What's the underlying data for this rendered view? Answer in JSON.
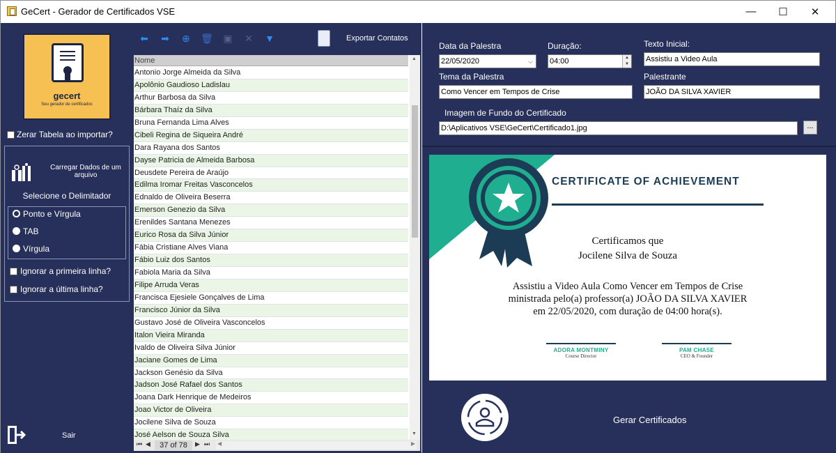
{
  "window": {
    "title": "GeCert - Gerador de Certificados VSE",
    "min": "—",
    "max": "☐",
    "close": "✕"
  },
  "logo": {
    "name": "gecert",
    "tagline": "Seu gerador de certificados"
  },
  "left": {
    "zerar_label": "Zerar Tabela ao importar?",
    "carregar_label": "Carregar Dados de um arquivo",
    "delimiter_label": "Selecione o Delimitador",
    "delimiters": [
      "Ponto e Vírgula",
      "TAB",
      "Vírgula"
    ],
    "selected_delimiter": "Ponto e Vírgula",
    "ignore_first": "Ignorar a primeira linha?",
    "ignore_last": "Ignorar a última linha?",
    "exit_label": "Sair"
  },
  "toolbar": {
    "export_label": "Exportar Contatos"
  },
  "grid": {
    "column": "Nome",
    "rows": [
      "Antonio Jorge Almeida da Silva",
      "Apolônio Gaudioso Ladislau",
      "Arthur Barbosa da Silva",
      "Bárbara Thaíz da Silva",
      "Bruna Fernanda Lima Alves",
      "Cibeli Regina de Siqueira André",
      "Dara Rayana dos Santos",
      "Dayse Patricia de Almeida Barbosa",
      "Deusdete Pereira de Araújo",
      "Edilma Iromar Freitas Vasconcelos",
      "Ednaldo de Oliveira Beserra",
      "Emerson Genezio da Silva",
      "Erenildes Santana Menezes",
      "Eurico Rosa da Silva Júnior",
      "Fábia Cristiane Alves Viana",
      "Fábio Luiz dos Santos",
      "Fabiola Maria da Silva",
      "Filipe Arruda Veras",
      "Francisca Ejesiele Gonçalves de Lima",
      "Francisco Júnior da Silva",
      "Gustavo José de Oliveira Vasconcelos",
      "Italon Vieira Miranda",
      "Ivaldo de Oliveira Silva Júnior",
      "Jaciane Gomes de Lima",
      "Jackson Genésio da Silva",
      "Jadson José Rafael dos Santos",
      "Joana Dark Henrique de Medeiros",
      "Joao Victor de Oliveira",
      "Jocilene Silva de Souza",
      "José Aelson de Souza Silva"
    ],
    "nav_count": "37 of 78"
  },
  "form": {
    "data_label": "Data da Palestra",
    "data_value": "22/05/2020",
    "duracao_label": "Duração:",
    "duracao_value": "04:00",
    "texto_label": "Texto Inicial:",
    "texto_value": "Assistiu a Video Aula",
    "tema_label": "Tema da Palestra",
    "tema_value": "Como Vencer em Tempos de Crise",
    "palestrante_label": "Palestrante",
    "palestrante_value": "JOÃO DA SILVA XAVIER",
    "imagem_label": "Imagem de Fundo do Certificado",
    "imagem_value": "D:\\Aplicativos VSE\\GeCert\\Certificado1.jpg",
    "browse_label": "..."
  },
  "certificate": {
    "heading": "CERTIFICATE OF ACHIEVEMENT",
    "line1": "Certificamos que",
    "line2": "Jocilene Silva de Souza",
    "body1": "Assistiu a Video Aula Como Vencer em Tempos de Crise",
    "body2": "ministrada pelo(a) professor(a) JOÃO DA SILVA XAVIER",
    "body3": "em 22/05/2020, com duração de  04:00 hora(s).",
    "sig1_name": "ADORA MONTMINY",
    "sig1_role": "Course Director",
    "sig2_name": "PAM CHASE",
    "sig2_role": "CEO & Founder",
    "accent": "#1fae8f",
    "navy": "#1c3c56"
  },
  "actions": {
    "gerar_label": "Gerar Certificados"
  },
  "colors": {
    "panel": "#26305a",
    "row_alt": "#eaf5e6",
    "logo_bg": "#f7c052"
  }
}
